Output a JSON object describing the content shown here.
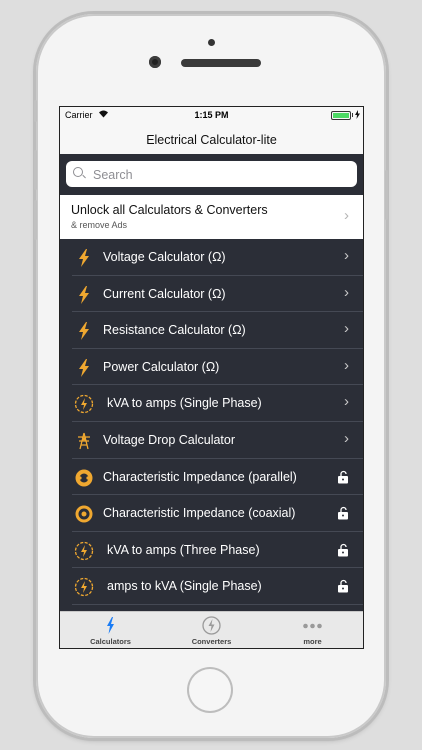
{
  "status": {
    "carrier": "Carrier",
    "time": "1:15 PM"
  },
  "navbar": {
    "title": "Electrical Calculator-lite"
  },
  "search": {
    "placeholder": "Search"
  },
  "promo": {
    "title": "Unlock all Calculators & Converters",
    "subtitle": "& remove Ads"
  },
  "items": [
    {
      "label": "Voltage Calculator (Ω)",
      "icon": "bolt-icon",
      "accessory": "chevron"
    },
    {
      "label": "Current Calculator (Ω)",
      "icon": "bolt-icon",
      "accessory": "chevron"
    },
    {
      "label": "Resistance Calculator (Ω)",
      "icon": "bolt-icon",
      "accessory": "chevron"
    },
    {
      "label": "Power Calculator (Ω)",
      "icon": "bolt-icon",
      "accessory": "chevron"
    },
    {
      "label": "kVA to amps (Single Phase)",
      "icon": "circle-bolt-icon",
      "accessory": "chevron"
    },
    {
      "label": "Voltage Drop Calculator",
      "icon": "tower-icon",
      "accessory": "chevron"
    },
    {
      "label": "Characteristic Impedance (parallel)",
      "icon": "impedance-parallel-icon",
      "accessory": "lock"
    },
    {
      "label": "Characteristic Impedance (coaxial)",
      "icon": "coax-icon",
      "accessory": "lock"
    },
    {
      "label": "kVA to amps (Three Phase)",
      "icon": "circle-bolt-icon",
      "accessory": "lock"
    },
    {
      "label": "amps to kVA (Single Phase)",
      "icon": "circle-bolt-icon",
      "accessory": "lock"
    }
  ],
  "tabs": [
    {
      "label": "Calculators",
      "icon": "bolt-icon",
      "active": true
    },
    {
      "label": "Converters",
      "icon": "circle-bolt-icon",
      "active": false
    },
    {
      "label": "more",
      "icon": "more-icon",
      "active": false
    }
  ],
  "colors": {
    "accent_orange": "#f0a830",
    "list_background": "#2b2e37",
    "tab_active": "#1a7cf5"
  }
}
